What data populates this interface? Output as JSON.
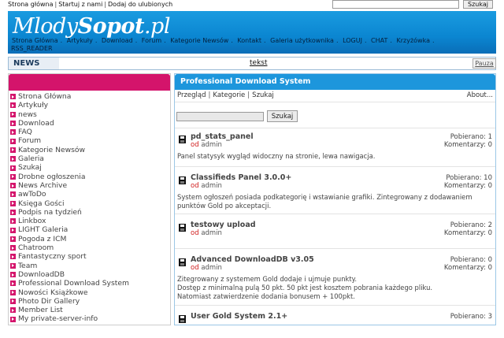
{
  "top": {
    "links": [
      "Strona główna",
      "Startuj z nami",
      "Dodaj do ulubionych"
    ],
    "search_value": "",
    "search_button": "Szukaj"
  },
  "banner": {
    "logo_part1": "Mlody",
    "logo_part2": "Sopot",
    "logo_part3": ".pl",
    "nav": [
      "Strona Główna",
      "Artykuły",
      "Download",
      "Forum",
      "Kategorie Newsów",
      "Kontakt",
      "Galeria użytkownika",
      "LOGUJ",
      "CHAT",
      "Krzyżówka"
    ],
    "nav2": "RSS_READER"
  },
  "news": {
    "label": "NEWS",
    "ticker": "tekst",
    "pause_label": "Pauza"
  },
  "sidebar": {
    "items": [
      "Strona Główna",
      "Artykuły",
      "news",
      "Download",
      "FAQ",
      "Forum",
      "Kategorie Newsów",
      "Galeria",
      "Szukaj",
      "Drobne ogłoszenia",
      "News Archive",
      "awToDo",
      "Księga Gości",
      "Podpis na tydzień",
      "Linkbox",
      "LIGHT Galeria",
      "Pogoda z ICM",
      "Chatroom",
      "Fantastyczny sport",
      "Team",
      "DownloadDB",
      "Professional Download System",
      "Nowości Książkowe",
      "Photo Dir Gallery",
      "Member List",
      "My private-server-info"
    ]
  },
  "panel": {
    "title": "Professional Download System",
    "links": [
      "Przegląd",
      "Kategorie",
      "Szukaj"
    ],
    "about": "About...",
    "search_value": "",
    "search_button": "Szukaj",
    "entries": [
      {
        "title": "pd_stats_panel",
        "od": "od",
        "author": "admin",
        "downloads": "Pobierano: 1",
        "comments": "Komentarzy: 0",
        "desc": "Panel statysyk wygląd widoczny na stronie, lewa nawigacja."
      },
      {
        "title": "Classifieds Panel 3.0.0+",
        "od": "od",
        "author": "admin",
        "downloads": "Pobierano: 10",
        "comments": "Komentarzy: 0",
        "desc": "System ogłoszeń posiada podkategorię i wstawianie grafiki. Zintegrowany z dodawaniem punktów Gold po akceptacji."
      },
      {
        "title": "testowy upload",
        "od": "od",
        "author": "admin",
        "downloads": "Pobierano: 2",
        "comments": "Komentarzy: 0",
        "desc": ""
      },
      {
        "title": "Advanced DownloadDB v3.05",
        "od": "od",
        "author": "admin",
        "downloads": "Pobierano: 0",
        "comments": "Komentarzy: 0",
        "desc": "Zitegrowany z systemem Gold dodaje i ujmuje punkty.\nDostęp z minimalną pulą 50 pkt. 50 pkt jest kosztem pobrania każdego pliku.\nNatomiast zatwierdzenie dodania bonusem + 100pkt."
      },
      {
        "title": "User Gold System 2.1+",
        "od": "",
        "author": "",
        "downloads": "Pobierano: 3",
        "comments": "",
        "desc": ""
      }
    ]
  },
  "colors": {
    "banner_blue": "#0b86d1",
    "sidebar_accent": "#d4146b",
    "panel_header": "#1d96dc",
    "author_od": "#d01d1d"
  }
}
